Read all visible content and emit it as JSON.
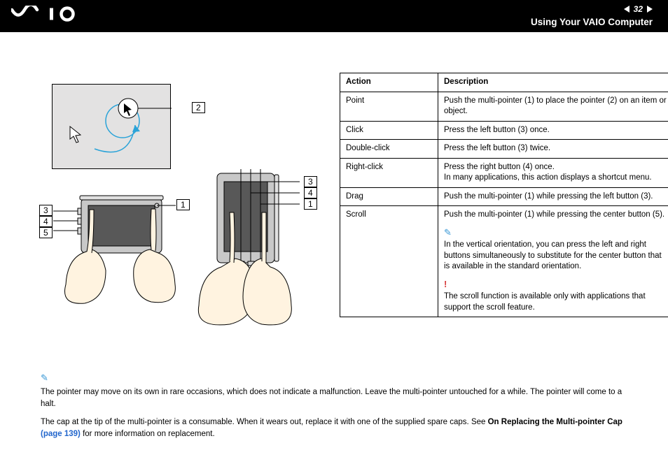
{
  "header": {
    "page_number": "32",
    "section_title": "Using Your VAIO Computer"
  },
  "callouts": {
    "screen_pointer": "2",
    "left_dev_top": "1",
    "left_dev_1": "3",
    "left_dev_2": "4",
    "left_dev_3": "5",
    "right_dev_1": "3",
    "right_dev_2": "4",
    "right_dev_3": "1"
  },
  "table": {
    "headers": {
      "action": "Action",
      "description": "Description"
    },
    "rows": [
      {
        "action": "Point",
        "description": "Push the multi-pointer (1) to place the pointer (2) on an item or object."
      },
      {
        "action": "Click",
        "description": "Press the left button (3) once."
      },
      {
        "action": "Double-click",
        "description": "Press the left button (3) twice."
      },
      {
        "action": "Right-click",
        "description": "Press the right button (4) once.\nIn many applications, this action displays a shortcut menu."
      },
      {
        "action": "Drag",
        "description": "Push the multi-pointer (1) while pressing the left button (3)."
      },
      {
        "action": "Scroll",
        "description": "Push the multi-pointer (1) while pressing the center button (5).",
        "note": "In the vertical orientation, you can press the left and right buttons simultaneously to substitute for the center button that is available in the standard orientation.",
        "warn": "The scroll function is available only with applications that support the scroll feature."
      }
    ]
  },
  "notes": {
    "p1": "The pointer may move on its own in rare occasions, which does not indicate a malfunction. Leave the multi-pointer untouched for a while. The pointer will come to a halt.",
    "p2a": "The cap at the tip of the multi-pointer is a consumable. When it wears out, replace it with one of the supplied spare caps. See ",
    "p2b_bold": "On Replacing the Multi-pointer Cap ",
    "p2b_link": "(page 139)",
    "p2c": " for more information on replacement."
  }
}
